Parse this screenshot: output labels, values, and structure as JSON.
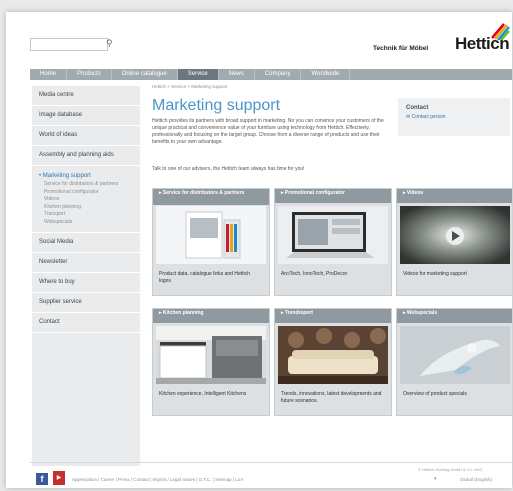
{
  "header": {
    "search_placeholder": "",
    "tagline": "Technik für Möbel",
    "logo": "Hettich",
    "brand_colors": [
      "#e4001b",
      "#f7a800",
      "#009ee0",
      "#7ab929"
    ]
  },
  "nav": {
    "items": [
      "Home",
      "Products",
      "Online catalogue",
      "Service",
      "News",
      "Company",
      "Worldwide"
    ],
    "active": "Service"
  },
  "sidebar": {
    "items": [
      "Media centre",
      "Image database",
      "World of ideas",
      "Assembly and planning aids"
    ],
    "active_label": "Marketing support",
    "subitems": [
      "Service for distributors & partners",
      "Promotional configurator",
      "Videos",
      "Kitchen planning",
      "Transport",
      "Webspecials"
    ],
    "items_after": [
      "Social Media",
      "Newsletter",
      "Where to buy",
      "Supplier service",
      "Contact"
    ]
  },
  "main": {
    "breadcrumb": "Hettich  >  Service  >  Marketing support",
    "title": "Marketing support",
    "intro": "Hettich provides its partners with broad support in marketing. No you can convince your customers of the unique practical and convenience value of your furniture using technology from Hettich. Effectively, professionally and focusing on the target group. Choose from a diverse range of products and use their benefits to your own advantage.",
    "intro2": "Talk to one of our advisers, the Hettich team always has time for you!"
  },
  "contact": {
    "title": "Contact",
    "link": "Contact person"
  },
  "cards": [
    {
      "title": "Service for distributors & partners",
      "text": "Product data, catalogue links and Hettich logos"
    },
    {
      "title": "Promotional configurator",
      "text": "ArciTech, InnoTech, ProDecor"
    },
    {
      "title": "Videos",
      "text": "Videos for marketing support"
    },
    {
      "title": "Kitchen planning",
      "text": "Kitchen experience, Intelligent Kitchens"
    },
    {
      "title": "Trendreport",
      "text": "Trends, innovations, latest developments and future scenarios."
    },
    {
      "title": "Webspecials",
      "text": "Overview of product specials"
    }
  ],
  "footer": {
    "links": "Appreciation  |  Career  |  Press  |  Contact  |  Imprint / Legal issues  |  G.T.C.  |  Sitemap  |  LoA",
    "copyright": "© Hettich Holding GmbH & Co. oHG",
    "language": "Global (English)"
  }
}
